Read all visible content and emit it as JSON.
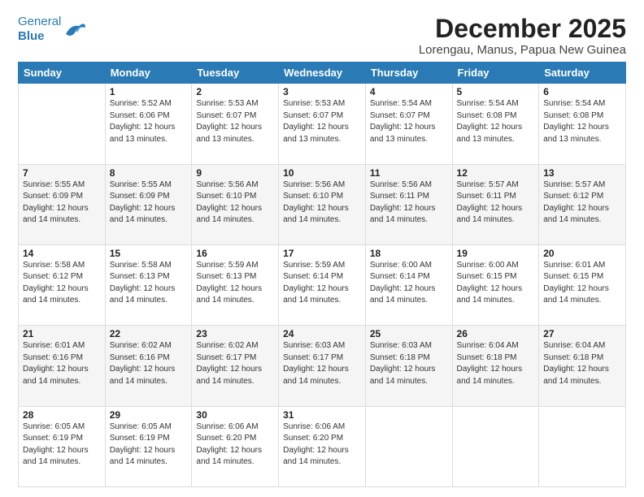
{
  "header": {
    "logo_line1": "General",
    "logo_line2": "Blue",
    "title": "December 2025",
    "subtitle": "Lorengau, Manus, Papua New Guinea"
  },
  "days_of_week": [
    "Sunday",
    "Monday",
    "Tuesday",
    "Wednesday",
    "Thursday",
    "Friday",
    "Saturday"
  ],
  "weeks": [
    [
      {
        "num": "",
        "info": ""
      },
      {
        "num": "1",
        "info": "Sunrise: 5:52 AM\nSunset: 6:06 PM\nDaylight: 12 hours\nand 13 minutes."
      },
      {
        "num": "2",
        "info": "Sunrise: 5:53 AM\nSunset: 6:07 PM\nDaylight: 12 hours\nand 13 minutes."
      },
      {
        "num": "3",
        "info": "Sunrise: 5:53 AM\nSunset: 6:07 PM\nDaylight: 12 hours\nand 13 minutes."
      },
      {
        "num": "4",
        "info": "Sunrise: 5:54 AM\nSunset: 6:07 PM\nDaylight: 12 hours\nand 13 minutes."
      },
      {
        "num": "5",
        "info": "Sunrise: 5:54 AM\nSunset: 6:08 PM\nDaylight: 12 hours\nand 13 minutes."
      },
      {
        "num": "6",
        "info": "Sunrise: 5:54 AM\nSunset: 6:08 PM\nDaylight: 12 hours\nand 13 minutes."
      }
    ],
    [
      {
        "num": "7",
        "info": "Sunrise: 5:55 AM\nSunset: 6:09 PM\nDaylight: 12 hours\nand 14 minutes."
      },
      {
        "num": "8",
        "info": "Sunrise: 5:55 AM\nSunset: 6:09 PM\nDaylight: 12 hours\nand 14 minutes."
      },
      {
        "num": "9",
        "info": "Sunrise: 5:56 AM\nSunset: 6:10 PM\nDaylight: 12 hours\nand 14 minutes."
      },
      {
        "num": "10",
        "info": "Sunrise: 5:56 AM\nSunset: 6:10 PM\nDaylight: 12 hours\nand 14 minutes."
      },
      {
        "num": "11",
        "info": "Sunrise: 5:56 AM\nSunset: 6:11 PM\nDaylight: 12 hours\nand 14 minutes."
      },
      {
        "num": "12",
        "info": "Sunrise: 5:57 AM\nSunset: 6:11 PM\nDaylight: 12 hours\nand 14 minutes."
      },
      {
        "num": "13",
        "info": "Sunrise: 5:57 AM\nSunset: 6:12 PM\nDaylight: 12 hours\nand 14 minutes."
      }
    ],
    [
      {
        "num": "14",
        "info": "Sunrise: 5:58 AM\nSunset: 6:12 PM\nDaylight: 12 hours\nand 14 minutes."
      },
      {
        "num": "15",
        "info": "Sunrise: 5:58 AM\nSunset: 6:13 PM\nDaylight: 12 hours\nand 14 minutes."
      },
      {
        "num": "16",
        "info": "Sunrise: 5:59 AM\nSunset: 6:13 PM\nDaylight: 12 hours\nand 14 minutes."
      },
      {
        "num": "17",
        "info": "Sunrise: 5:59 AM\nSunset: 6:14 PM\nDaylight: 12 hours\nand 14 minutes."
      },
      {
        "num": "18",
        "info": "Sunrise: 6:00 AM\nSunset: 6:14 PM\nDaylight: 12 hours\nand 14 minutes."
      },
      {
        "num": "19",
        "info": "Sunrise: 6:00 AM\nSunset: 6:15 PM\nDaylight: 12 hours\nand 14 minutes."
      },
      {
        "num": "20",
        "info": "Sunrise: 6:01 AM\nSunset: 6:15 PM\nDaylight: 12 hours\nand 14 minutes."
      }
    ],
    [
      {
        "num": "21",
        "info": "Sunrise: 6:01 AM\nSunset: 6:16 PM\nDaylight: 12 hours\nand 14 minutes."
      },
      {
        "num": "22",
        "info": "Sunrise: 6:02 AM\nSunset: 6:16 PM\nDaylight: 12 hours\nand 14 minutes."
      },
      {
        "num": "23",
        "info": "Sunrise: 6:02 AM\nSunset: 6:17 PM\nDaylight: 12 hours\nand 14 minutes."
      },
      {
        "num": "24",
        "info": "Sunrise: 6:03 AM\nSunset: 6:17 PM\nDaylight: 12 hours\nand 14 minutes."
      },
      {
        "num": "25",
        "info": "Sunrise: 6:03 AM\nSunset: 6:18 PM\nDaylight: 12 hours\nand 14 minutes."
      },
      {
        "num": "26",
        "info": "Sunrise: 6:04 AM\nSunset: 6:18 PM\nDaylight: 12 hours\nand 14 minutes."
      },
      {
        "num": "27",
        "info": "Sunrise: 6:04 AM\nSunset: 6:18 PM\nDaylight: 12 hours\nand 14 minutes."
      }
    ],
    [
      {
        "num": "28",
        "info": "Sunrise: 6:05 AM\nSunset: 6:19 PM\nDaylight: 12 hours\nand 14 minutes."
      },
      {
        "num": "29",
        "info": "Sunrise: 6:05 AM\nSunset: 6:19 PM\nDaylight: 12 hours\nand 14 minutes."
      },
      {
        "num": "30",
        "info": "Sunrise: 6:06 AM\nSunset: 6:20 PM\nDaylight: 12 hours\nand 14 minutes."
      },
      {
        "num": "31",
        "info": "Sunrise: 6:06 AM\nSunset: 6:20 PM\nDaylight: 12 hours\nand 14 minutes."
      },
      {
        "num": "",
        "info": ""
      },
      {
        "num": "",
        "info": ""
      },
      {
        "num": "",
        "info": ""
      }
    ]
  ]
}
